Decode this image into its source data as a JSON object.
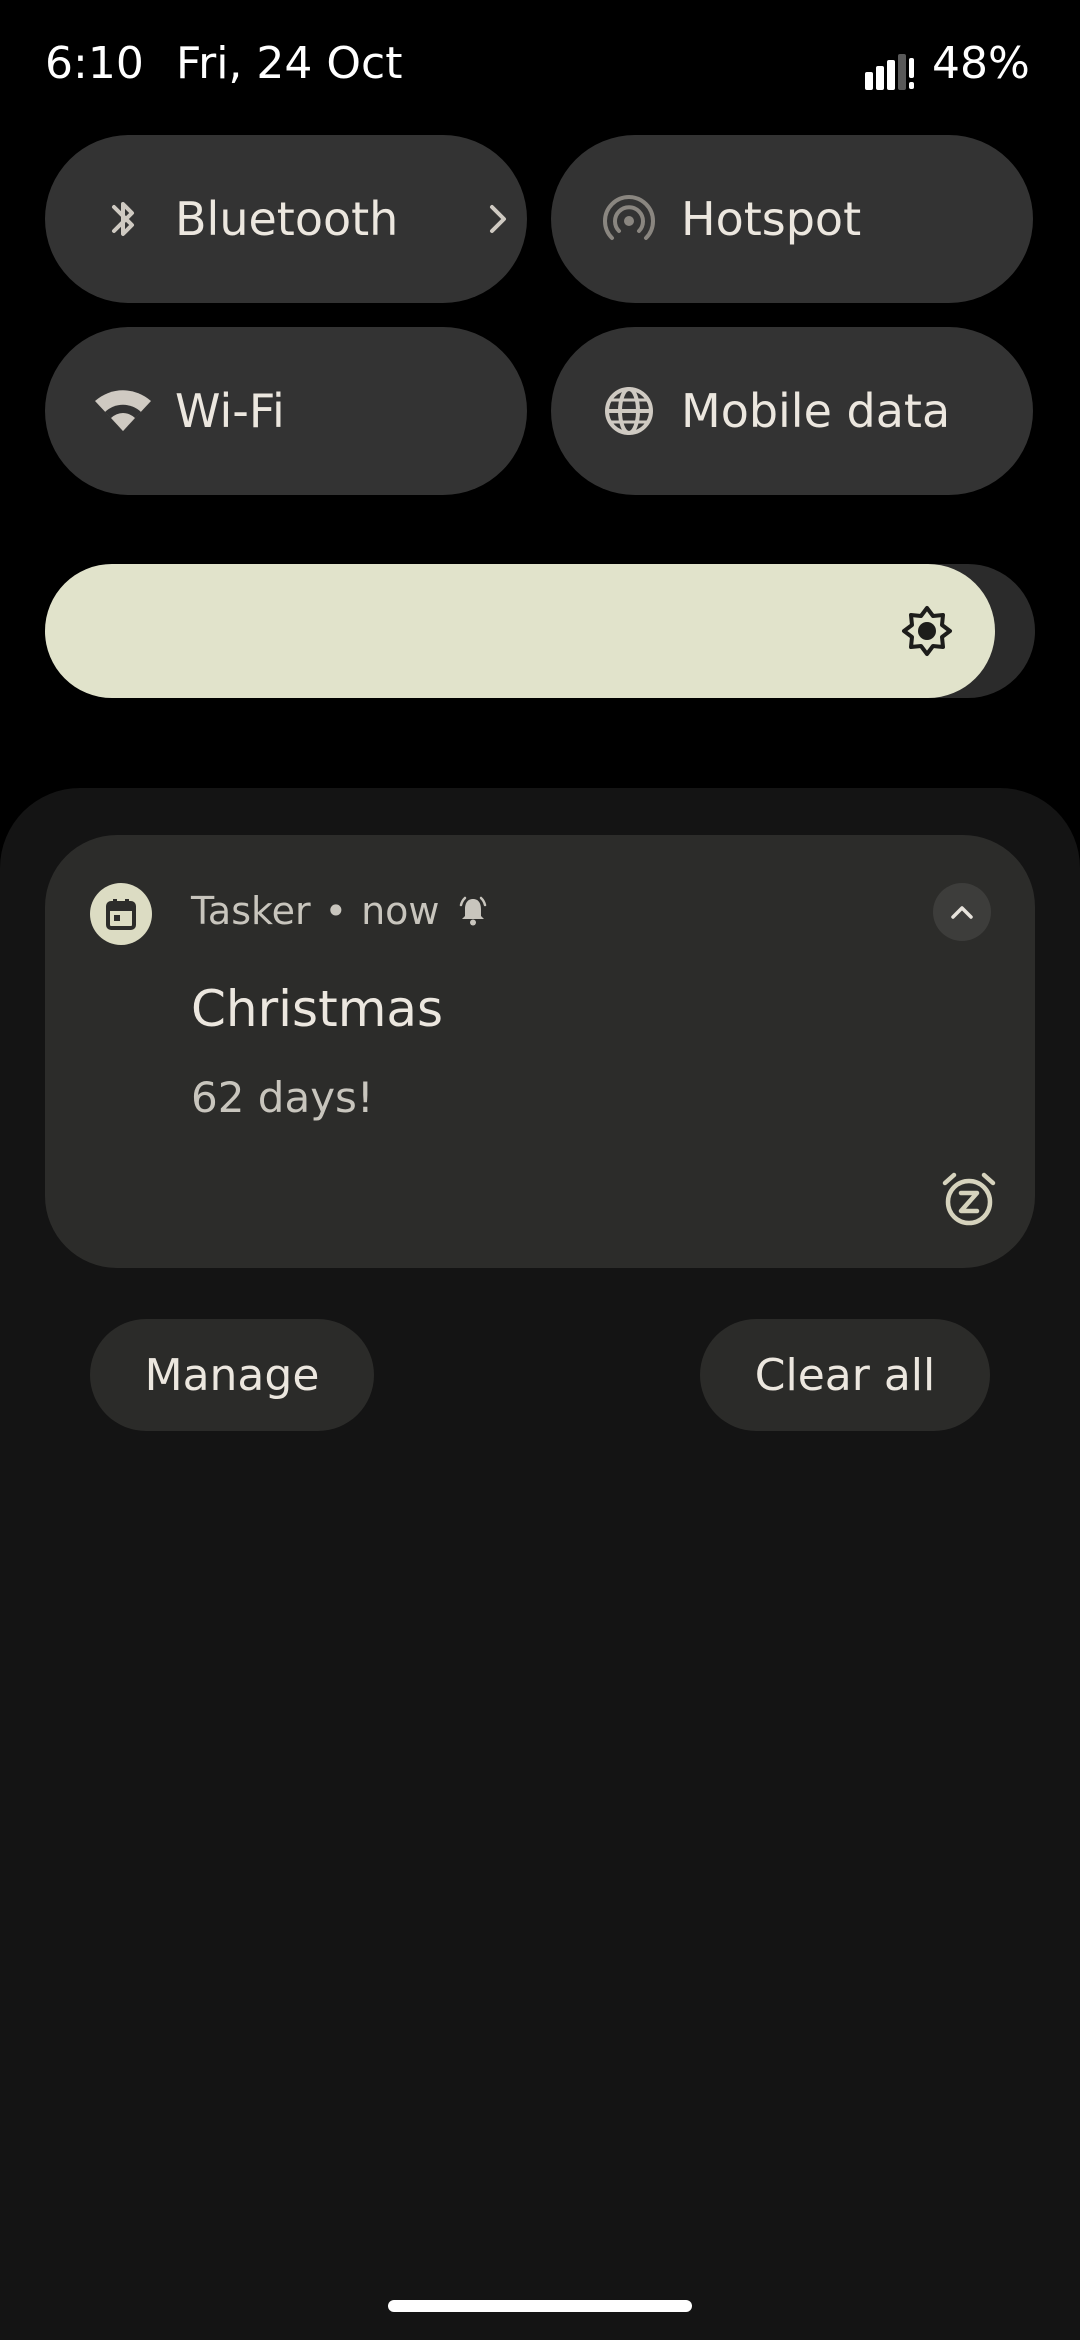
{
  "status_bar": {
    "time": "6:10",
    "date": "Fri, 24 Oct",
    "battery": "48%"
  },
  "quick_settings": {
    "tiles": [
      {
        "label": "Bluetooth",
        "icon": "bluetooth-icon",
        "has_chevron": true
      },
      {
        "label": "Hotspot",
        "icon": "hotspot-icon"
      },
      {
        "label": "Wi-Fi",
        "icon": "wifi-icon"
      },
      {
        "label": "Mobile data",
        "icon": "globe-icon"
      }
    ],
    "brightness_level": 0.96
  },
  "notification": {
    "app_name": "Tasker",
    "separator": "•",
    "time": "now",
    "title": "Christmas",
    "text": "62 days!",
    "icons": {
      "app": "calendar-icon",
      "alert": "bell-icon",
      "collapse": "chevron-up-icon",
      "snooze": "snooze-icon"
    }
  },
  "actions": {
    "manage_label": "Manage",
    "clear_all_label": "Clear all"
  },
  "colors": {
    "background": "#000000",
    "tile": "#333333",
    "brightness_fill": "#e1e3cb",
    "shade": "#141414",
    "card": "#2c2c2a",
    "text_primary": "#ece7df",
    "text_secondary": "#c8c5bd"
  }
}
